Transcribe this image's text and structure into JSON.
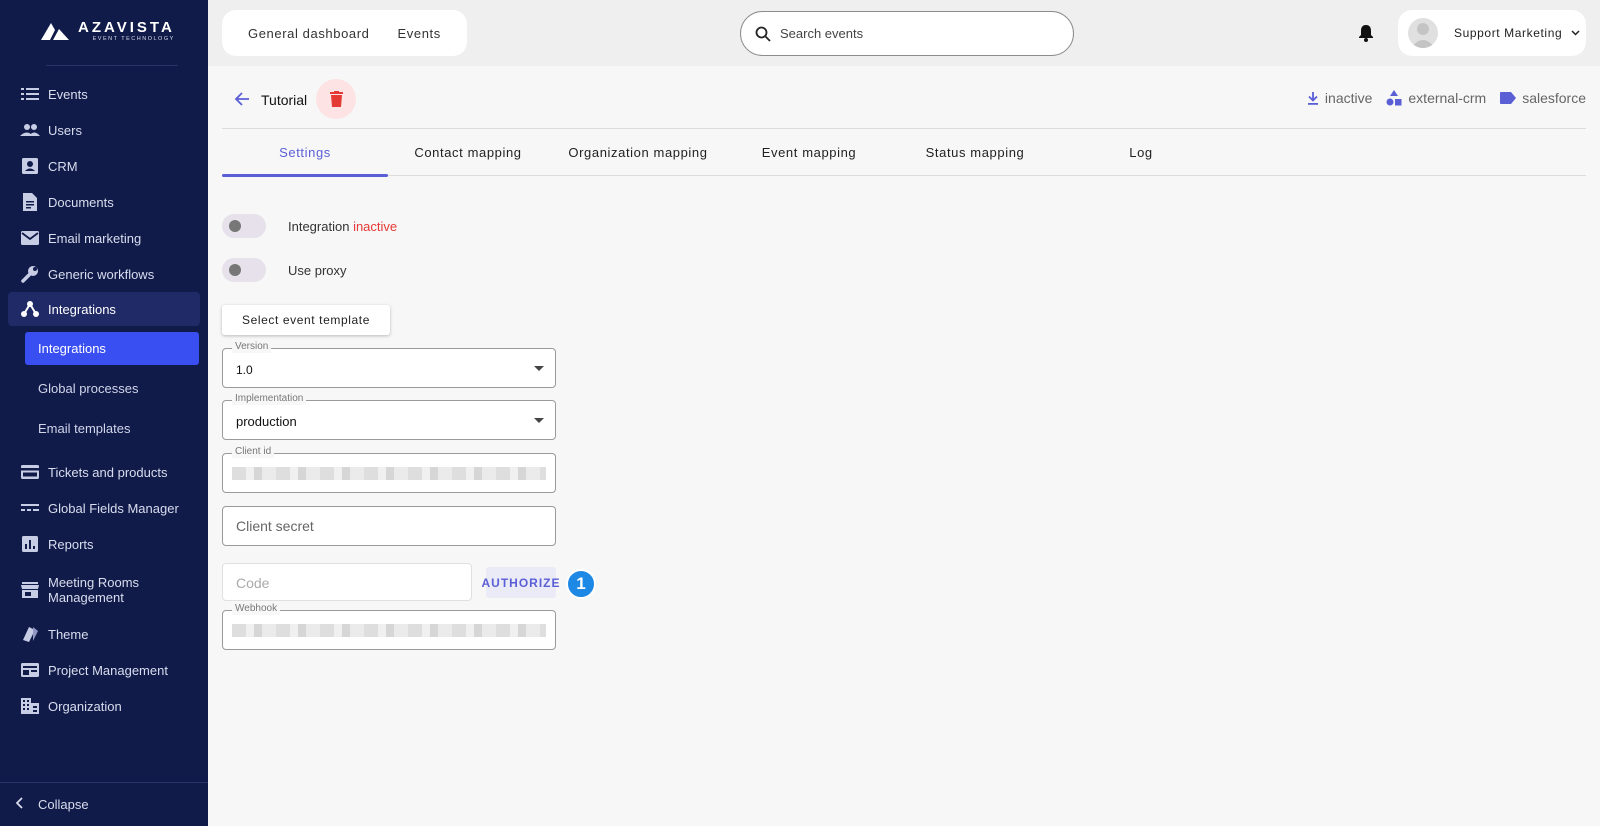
{
  "brand": {
    "name": "AZAVISTA",
    "tagline": "EVENT TECHNOLOGY"
  },
  "sidebar": {
    "items": [
      {
        "label": "Events",
        "icon": "list-icon"
      },
      {
        "label": "Users",
        "icon": "people-icon"
      },
      {
        "label": "CRM",
        "icon": "contact-card-icon"
      },
      {
        "label": "Documents",
        "icon": "document-icon"
      },
      {
        "label": "Email marketing",
        "icon": "envelope-icon"
      },
      {
        "label": "Generic workflows",
        "icon": "wrench-icon"
      },
      {
        "label": "Integrations",
        "icon": "hub-icon"
      },
      {
        "label": "Tickets and products",
        "icon": "card-icon"
      },
      {
        "label": "Global Fields Manager",
        "icon": "fields-icon"
      },
      {
        "label": "Reports",
        "icon": "bar-chart-icon"
      },
      {
        "label": "Meeting Rooms Management",
        "icon": "store-icon"
      },
      {
        "label": "Theme",
        "icon": "palette-icon"
      },
      {
        "label": "Project Management",
        "icon": "board-icon"
      },
      {
        "label": "Organization",
        "icon": "building-icon"
      }
    ],
    "sub_items": [
      {
        "label": "Integrations"
      },
      {
        "label": "Global processes"
      },
      {
        "label": "Email templates"
      }
    ],
    "collapse_label": "Collapse"
  },
  "topbar": {
    "tabs": [
      "General dashboard",
      "Events"
    ],
    "search_placeholder": "Search events",
    "user_name": "Support Marketing"
  },
  "header": {
    "title": "Tutorial",
    "meta": [
      {
        "label": "inactive",
        "icon": "download-icon"
      },
      {
        "label": "external-crm",
        "icon": "shapes-icon"
      },
      {
        "label": "salesforce",
        "icon": "tag-icon"
      }
    ]
  },
  "tabs": [
    "Settings",
    "Contact mapping",
    "Organization mapping",
    "Event mapping",
    "Status mapping",
    "Log"
  ],
  "settings": {
    "integration_label": "Integration",
    "integration_status": "inactive",
    "proxy_label": "Use proxy",
    "template_button": "Select event template",
    "version": {
      "label": "Version",
      "value": "1.0"
    },
    "implementation": {
      "label": "Implementation",
      "value": "production"
    },
    "client_id": {
      "label": "Client id"
    },
    "client_secret": {
      "placeholder": "Client secret"
    },
    "code": {
      "placeholder": "Code"
    },
    "authorize_button": "AUTHORIZE",
    "step_badge": "1",
    "webhook": {
      "label": "Webhook"
    }
  },
  "colors": {
    "sidebar_bg": "#101b4a",
    "accent": "#5b5fd6",
    "sub_active": "#3a4ff2",
    "danger": "#e53935",
    "badge": "#1e88e5"
  }
}
